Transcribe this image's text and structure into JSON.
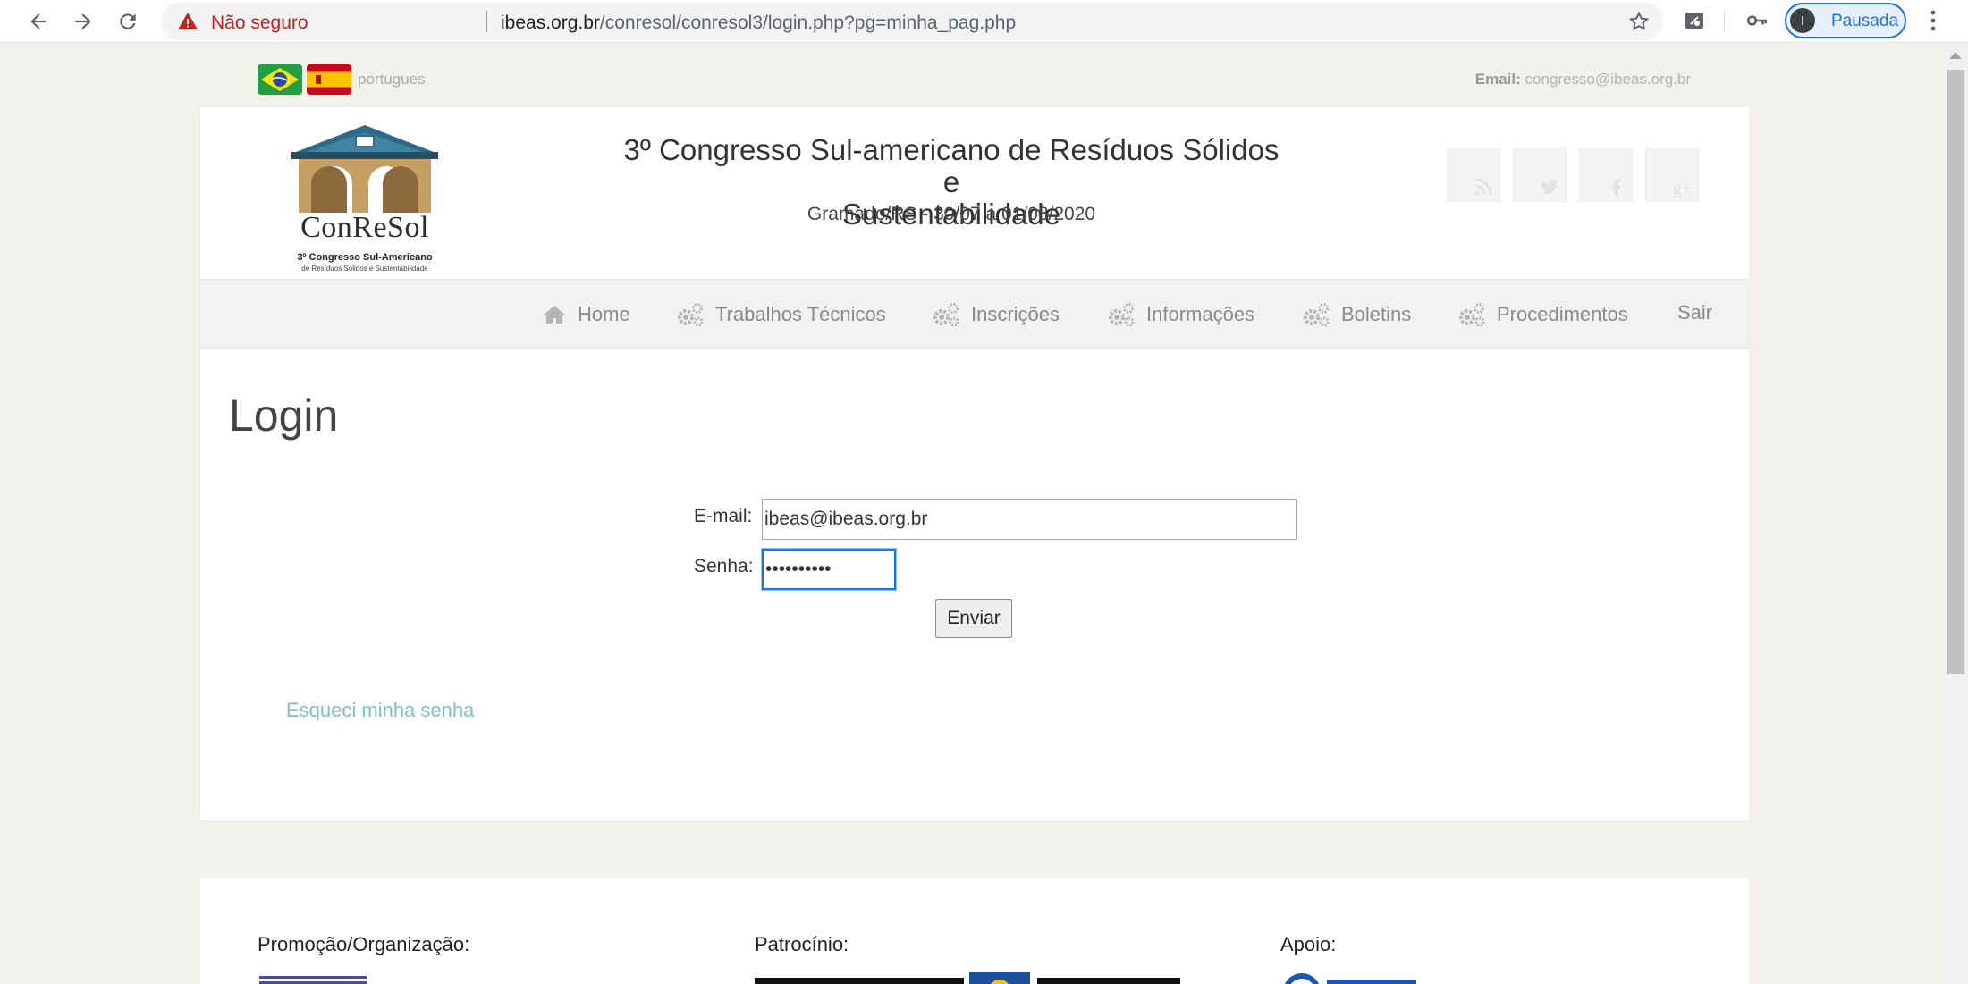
{
  "browser": {
    "security_label": "Não seguro",
    "url_host": "ibeas.org.br",
    "url_path": "/conresol/conresol3/login.php?pg=minha_pag.php",
    "profile_initial": "I",
    "profile_label": "Pausada"
  },
  "topbar": {
    "language_label": "portugues",
    "email_prefix": "Email:",
    "email_value": "congresso@ibeas.org.br"
  },
  "header": {
    "logo_brand": "ConReSol",
    "logo_tagline_1": "3º Congresso Sul-Americano",
    "logo_tagline_2": "de Resíduos Sólidos e Sustentabilidade",
    "title_line_1": "3º Congresso Sul-americano de Resíduos Sólidos e",
    "title_line_2": "Sustentabilidade",
    "subtitle": "Gramado/RS - 30/07 a 01/08/2020",
    "social_icons": [
      "rss-icon",
      "twitter-icon",
      "facebook-icon",
      "google-plus-icon"
    ]
  },
  "nav": {
    "items": [
      {
        "label": "Home",
        "icon": "home-icon"
      },
      {
        "label": "Trabalhos Técnicos",
        "icon": "gears-icon"
      },
      {
        "label": "Inscrições",
        "icon": "gears-icon"
      },
      {
        "label": "Informações",
        "icon": "gears-icon"
      },
      {
        "label": "Boletins",
        "icon": "gears-icon"
      },
      {
        "label": "Procedimentos",
        "icon": "gears-icon"
      },
      {
        "label": "Sair",
        "icon": ""
      }
    ]
  },
  "login": {
    "heading": "Login",
    "email_label": "E-mail:",
    "email_value": "ibeas@ibeas.org.br",
    "password_label": "Senha:",
    "password_value": "••••••••••",
    "submit_label": "Enviar",
    "forgot_label": "Esqueci minha senha"
  },
  "footer": {
    "promo_label": "Promoção/Organização:",
    "sponsor_label": "Patrocínio:",
    "support_label": "Apoio:"
  },
  "colors": {
    "page_bg": "#f3f1ec",
    "link": "#7fbfc3",
    "nav_bg": "#f2f2f2",
    "focus": "#1a73e8",
    "warning": "#c5221f"
  }
}
